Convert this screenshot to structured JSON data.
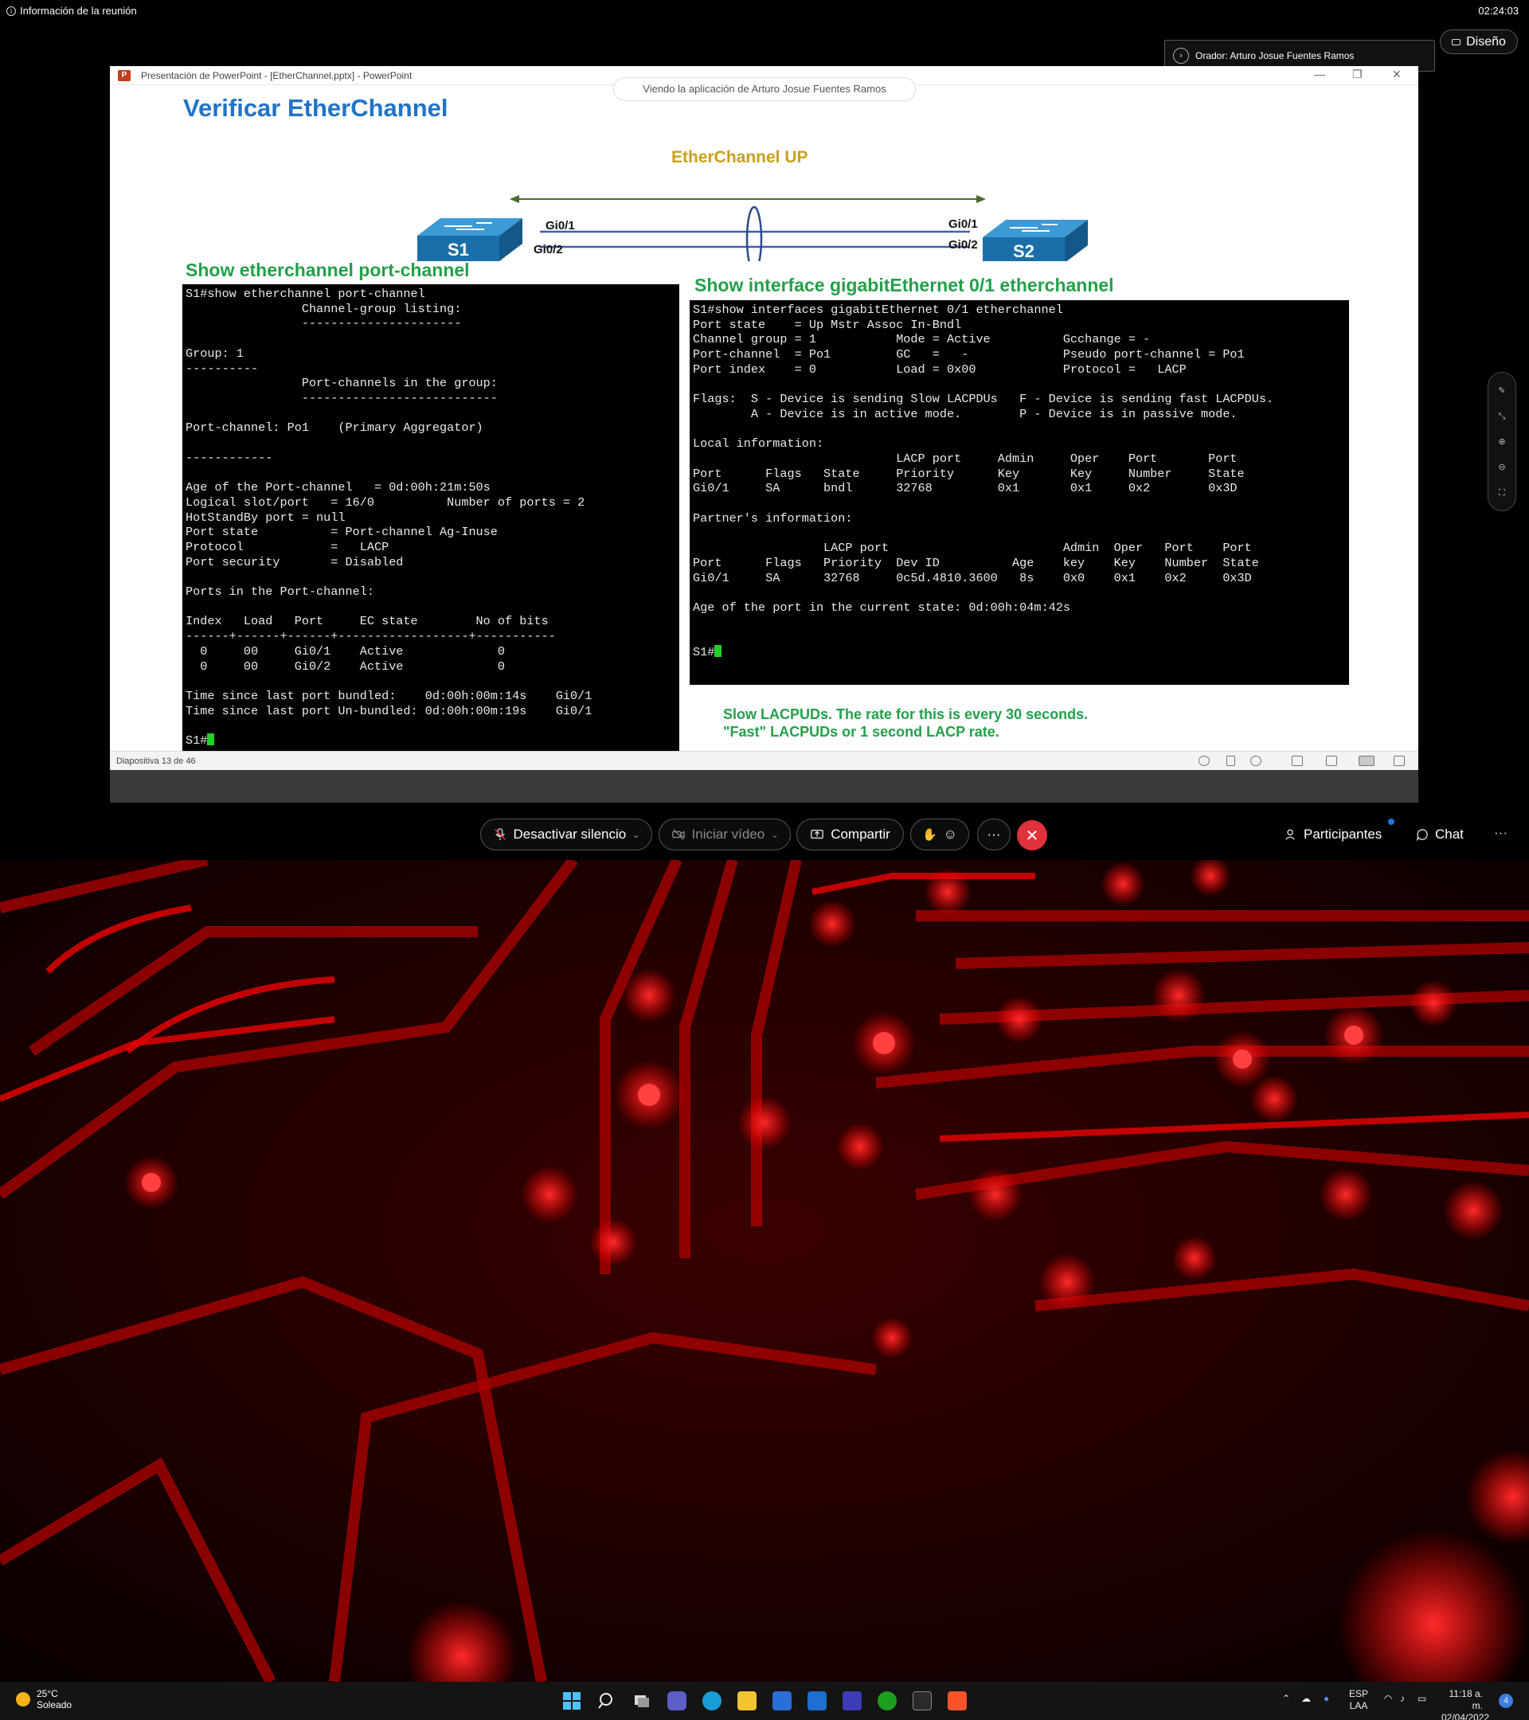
{
  "meeting": {
    "info_label": "Información de la reunión",
    "time": "02:24:03",
    "design_label": "Diseño",
    "speaker_label": "Orador: Arturo Josue Fuentes Ramos",
    "viewing_banner": "Viendo la aplicación de Arturo Josue Fuentes Ramos"
  },
  "powerpoint": {
    "window_title": "Presentación de PowerPoint - [EtherChannel.pptx] - PowerPoint",
    "slide_counter": "Diapositiva 13 de 46"
  },
  "slide": {
    "title": "Verificar EtherChannel",
    "etherchannel_label": "EtherChannel UP",
    "diagram": {
      "s1": "S1",
      "s2": "S2",
      "s1_port1": "Gi0/1",
      "s1_port2": "Gi0/2",
      "s2_port1": "Gi0/1",
      "s2_port2": "Gi0/2"
    },
    "left_heading": "Show etherchannel port-channel",
    "right_heading": "Show interface gigabitEthernet 0/1 etherchannel",
    "left_terminal": [
      "S1#show etherchannel port-channel",
      "                Channel-group listing:",
      "                ----------------------",
      "",
      "Group: 1",
      "----------",
      "                Port-channels in the group:",
      "                ---------------------------",
      "",
      "Port-channel: Po1    (Primary Aggregator)",
      "",
      "------------",
      "",
      "Age of the Port-channel   = 0d:00h:21m:50s",
      "Logical slot/port   = 16/0          Number of ports = 2",
      "HotStandBy port = null",
      "Port state          = Port-channel Ag-Inuse",
      "Protocol            =   LACP",
      "Port security       = Disabled",
      "",
      "Ports in the Port-channel:",
      "",
      "Index   Load   Port     EC state        No of bits",
      "------+------+------+------------------+-----------",
      "  0     00     Gi0/1    Active             0",
      "  0     00     Gi0/2    Active             0",
      "",
      "Time since last port bundled:    0d:00h:00m:14s    Gi0/1",
      "Time since last port Un-bundled: 0d:00h:00m:19s    Gi0/1",
      "",
      "S1#"
    ],
    "right_terminal": [
      "S1#show interfaces gigabitEthernet 0/1 etherchannel",
      "Port state    = Up Mstr Assoc In-Bndl",
      "Channel group = 1           Mode = Active          Gcchange = -",
      "Port-channel  = Po1         GC   =   -             Pseudo port-channel = Po1",
      "Port index    = 0           Load = 0x00            Protocol =   LACP",
      "",
      "Flags:  S - Device is sending Slow LACPDUs   F - Device is sending fast LACPDUs.",
      "        A - Device is in active mode.        P - Device is in passive mode.",
      "",
      "Local information:",
      "                            LACP port     Admin     Oper    Port       Port",
      "Port      Flags   State     Priority      Key       Key     Number     State",
      "Gi0/1     SA      bndl      32768         0x1       0x1     0x2        0x3D",
      "",
      "Partner's information:",
      "",
      "                  LACP port                        Admin  Oper   Port    Port",
      "Port      Flags   Priority  Dev ID          Age    key    Key    Number  State",
      "Gi0/1     SA      32768     0c5d.4810.3600   8s    0x0    0x1    0x2     0x3D",
      "",
      "Age of the port in the current state: 0d:00h:04m:42s",
      "",
      "",
      "S1#"
    ],
    "note_line1": "Slow LACPUDs. The rate for this is every 30 seconds.",
    "note_line2": "\"Fast\" LACPUDs or 1 second LACP rate."
  },
  "controls": {
    "mute_label": "Desactivar silencio",
    "video_label": "Iniciar vídeo",
    "share_label": "Compartir",
    "more_label": "···",
    "participants_label": "Participantes",
    "chat_label": "Chat",
    "overflow_label": "···"
  },
  "taskbar": {
    "weather_temp": "25°C",
    "weather_desc": "Soleado",
    "lang_top": "ESP",
    "lang_bottom": "LAA",
    "clock_time": "11:18 a. m.",
    "clock_date": "02/04/2022",
    "notif_count": "4"
  },
  "colors": {
    "slide_title": "#1f73c8",
    "slide_heading": "#22a04a",
    "etherchannel_label": "#c8a01e",
    "leave_button": "#e0323c",
    "switch_body": "#1b6fa8",
    "wallpaper": "#cc0000"
  }
}
